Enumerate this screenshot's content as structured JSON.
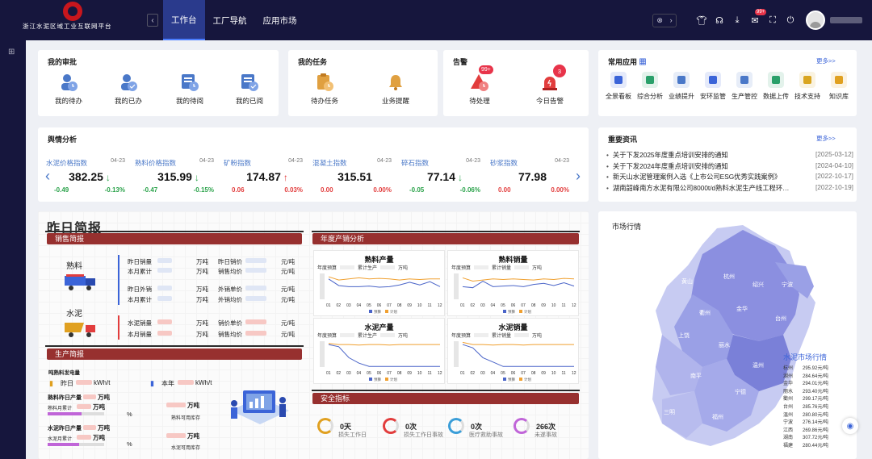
{
  "header": {
    "logo_text": "浙江水泥区域工业互联网平台",
    "nav_tabs": [
      {
        "label": "工作台",
        "active": true
      },
      {
        "label": "工厂导航"
      },
      {
        "label": "应用市场"
      }
    ],
    "msg_badge": "99+"
  },
  "approval": {
    "title": "我的审批",
    "items": [
      {
        "label": "我的待办"
      },
      {
        "label": "我的已办"
      },
      {
        "label": "我的待阅"
      },
      {
        "label": "我的已阅"
      }
    ]
  },
  "tasks": {
    "title": "我的任务",
    "items": [
      {
        "label": "待办任务"
      },
      {
        "label": "业务提醒"
      }
    ]
  },
  "alarm": {
    "title": "告警",
    "items": [
      {
        "label": "待处理",
        "badge": "99+"
      },
      {
        "label": "今日告警",
        "badge": "3"
      }
    ]
  },
  "apps": {
    "title": "常用应用",
    "more": "更多>>",
    "items": [
      {
        "label": "全景看板",
        "color": "#3b64d8"
      },
      {
        "label": "综合分析",
        "color": "#2aa06a"
      },
      {
        "label": "业绩提升",
        "color": "#4a78c8"
      },
      {
        "label": "安环监管",
        "color": "#3b64d8"
      },
      {
        "label": "生产管控",
        "color": "#4a78c8"
      },
      {
        "label": "数据上传",
        "color": "#2aa06a"
      },
      {
        "label": "技术支持",
        "color": "#d9a520"
      },
      {
        "label": "知识库",
        "color": "#e0a020"
      }
    ]
  },
  "sentiment": {
    "title": "舆情分析",
    "indices": [
      {
        "name": "水泥价格指数",
        "date": "04-23",
        "value": "382.25",
        "arrow": "↓",
        "dir": "dn",
        "change": "-0.49",
        "pct": "-0.13%"
      },
      {
        "name": "熟料价格指数",
        "date": "04-23",
        "value": "315.99",
        "arrow": "↓",
        "dir": "dn",
        "change": "-0.47",
        "pct": "-0.15%"
      },
      {
        "name": "矿粉指数",
        "date": "04-23",
        "value": "174.87",
        "arrow": "↑",
        "dir": "up",
        "change": "0.06",
        "pct": "0.03%"
      },
      {
        "name": "混凝土指数",
        "date": "04-23",
        "value": "315.51",
        "arrow": "",
        "dir": "zr",
        "change": "0.00",
        "pct": "0.00%"
      },
      {
        "name": "碎石指数",
        "date": "04-23",
        "value": "77.14",
        "arrow": "↓",
        "dir": "dn",
        "change": "-0.05",
        "pct": "-0.06%"
      },
      {
        "name": "砂浆指数",
        "date": "04-23",
        "value": "77.98",
        "arrow": "",
        "dir": "zr",
        "change": "0.00",
        "pct": "0.00%"
      }
    ]
  },
  "news": {
    "title": "重要资讯",
    "more": "更多>>",
    "items": [
      {
        "text": "关于下发2025年度重点培训安排的通知",
        "date": "[2025-03-12]"
      },
      {
        "text": "关于下发2024年度重点培训安排的通知",
        "date": "[2024-04-10]"
      },
      {
        "text": "新天山水泥管理案例入选《上市公司ESG优秀实践案例》",
        "date": "[2022-10-17]"
      },
      {
        "text": "湖南韶峰南方水泥有限公司8000t/d熟料水泥生产线工程环…",
        "date": "[2022-10-19]"
      }
    ]
  },
  "report": {
    "title": "昨日简报",
    "sales_brief": "销售简报",
    "clinker": "熟料",
    "cement": "水泥",
    "labels": {
      "yday_sales": "昨日销量",
      "month_total": "本月累计",
      "yday_out": "昨日外销",
      "yday_price": "昨日销价",
      "sales_avg": "销售均价",
      "out_price": "外销单价",
      "out_avg": "外销均价",
      "cement_sales": "水泥销量",
      "month_sales": "本月销量",
      "sale_price": "销价单价",
      "sale_avg": "销售均价"
    },
    "units": {
      "wt": "万吨",
      "yuan_t": "元/吨"
    },
    "annual_title": "年度产销分析",
    "mini_charts": [
      {
        "title": "熟料产量",
        "left": "年度预算",
        "right": "累计生产",
        "unit": "万吨"
      },
      {
        "title": "熟料销量",
        "left": "年度预算",
        "right": "累计销量",
        "unit": "万吨"
      },
      {
        "title": "水泥产量",
        "left": "年度预算",
        "right": "累计生产",
        "unit": "万吨"
      },
      {
        "title": "水泥销量",
        "left": "年度预算",
        "right": "累计销量",
        "unit": "万吨"
      }
    ],
    "months": [
      "01",
      "02",
      "03",
      "04",
      "05",
      "06",
      "07",
      "08",
      "09",
      "10",
      "11",
      "12"
    ],
    "legend": [
      "预算",
      "计划"
    ],
    "prod_brief": "生产简报",
    "power": "吨熟料发电量",
    "yesterday": "昨日",
    "this_year": "本年",
    "kwh_t": "kWh/t",
    "clinker_output": "熟料昨日产量",
    "clinker_month": "熟料月累计",
    "clinker_stock": "熟料可用库存",
    "cement_output": "水泥昨日产量",
    "cement_month": "水泥月累计",
    "cement_stock": "水泥可用库存",
    "pct_sign": "%",
    "safety_title": "安全指标",
    "safety": [
      {
        "value": "0天",
        "label": "损失工作日",
        "color": "#e0a020"
      },
      {
        "value": "0次",
        "label": "损失工作日事故",
        "color": "#e23d3d"
      },
      {
        "value": "0次",
        "label": "医疗救助事故",
        "color": "#3b9ed8"
      },
      {
        "value": "266次",
        "label": "未遂事故",
        "color": "#c065d8"
      }
    ]
  },
  "market": {
    "title": "市场行情",
    "cities": [
      "杭州",
      "湖州",
      "嘉兴",
      "宁波",
      "绍兴",
      "金华",
      "衢州",
      "台州",
      "丽水",
      "温州",
      "舟山"
    ],
    "price_title": "水泥市场行情",
    "prices": [
      {
        "city": "杭州",
        "price": "295.92元/吨"
      },
      {
        "city": "湖州",
        "price": "284.64元/吨"
      },
      {
        "city": "金华",
        "price": "294.01元/吨"
      },
      {
        "city": "丽水",
        "price": "293.40元/吨"
      },
      {
        "city": "衢州",
        "price": "299.17元/吨"
      },
      {
        "city": "台州",
        "price": "285.76元/吨"
      },
      {
        "city": "温州",
        "price": "280.80元/吨"
      },
      {
        "city": "宁波",
        "price": "276.14元/吨"
      },
      {
        "city": "江西",
        "price": "269.86元/吨"
      },
      {
        "city": "湖南",
        "price": "307.72元/吨"
      },
      {
        "city": "福建",
        "price": "280.44元/吨"
      }
    ]
  },
  "chart_data": [
    {
      "type": "line",
      "title": "熟料产量",
      "categories": [
        "01",
        "02",
        "03",
        "04",
        "05",
        "06",
        "07",
        "08",
        "09",
        "10",
        "11",
        "12"
      ],
      "series": [
        {
          "name": "预算",
          "values": [
            40,
            28,
            26,
            26,
            27,
            25,
            26,
            29,
            34,
            29,
            35,
            26
          ]
        },
        {
          "name": "计划",
          "values": [
            44,
            38,
            40,
            42,
            40,
            41,
            40,
            38,
            40,
            39,
            40,
            40
          ]
        }
      ]
    },
    {
      "type": "line",
      "title": "熟料销量",
      "categories": [
        "01",
        "02",
        "03",
        "04",
        "05",
        "06",
        "07",
        "08",
        "09",
        "10",
        "11",
        "12"
      ],
      "series": [
        {
          "name": "预算",
          "values": [
            26,
            24,
            36,
            26,
            27,
            28,
            26,
            30,
            32,
            28,
            33,
            27
          ]
        },
        {
          "name": "计划",
          "values": [
            42,
            36,
            38,
            40,
            39,
            40,
            39,
            38,
            40,
            39,
            41,
            40
          ]
        }
      ]
    },
    {
      "type": "line",
      "title": "水泥产量",
      "categories": [
        "01",
        "02",
        "03",
        "04",
        "05",
        "06",
        "07",
        "08",
        "09",
        "10",
        "11",
        "12"
      ],
      "series": [
        {
          "name": "预算",
          "values": [
            44,
            40,
            20,
            10,
            4,
            4,
            4,
            4,
            4,
            4,
            4,
            4
          ]
        },
        {
          "name": "计划",
          "values": [
            46,
            44,
            44,
            43,
            44,
            44,
            43,
            44,
            44,
            44,
            44,
            44
          ]
        }
      ]
    },
    {
      "type": "line",
      "title": "水泥销量",
      "categories": [
        "01",
        "02",
        "03",
        "04",
        "05",
        "06",
        "07",
        "08",
        "09",
        "10",
        "11",
        "12"
      ],
      "series": [
        {
          "name": "预算",
          "values": [
            44,
            38,
            20,
            12,
            4,
            4,
            4,
            4,
            4,
            4,
            4,
            4
          ]
        },
        {
          "name": "计划",
          "values": [
            48,
            44,
            44,
            43,
            44,
            44,
            43,
            44,
            44,
            44,
            44,
            44
          ]
        }
      ]
    }
  ]
}
